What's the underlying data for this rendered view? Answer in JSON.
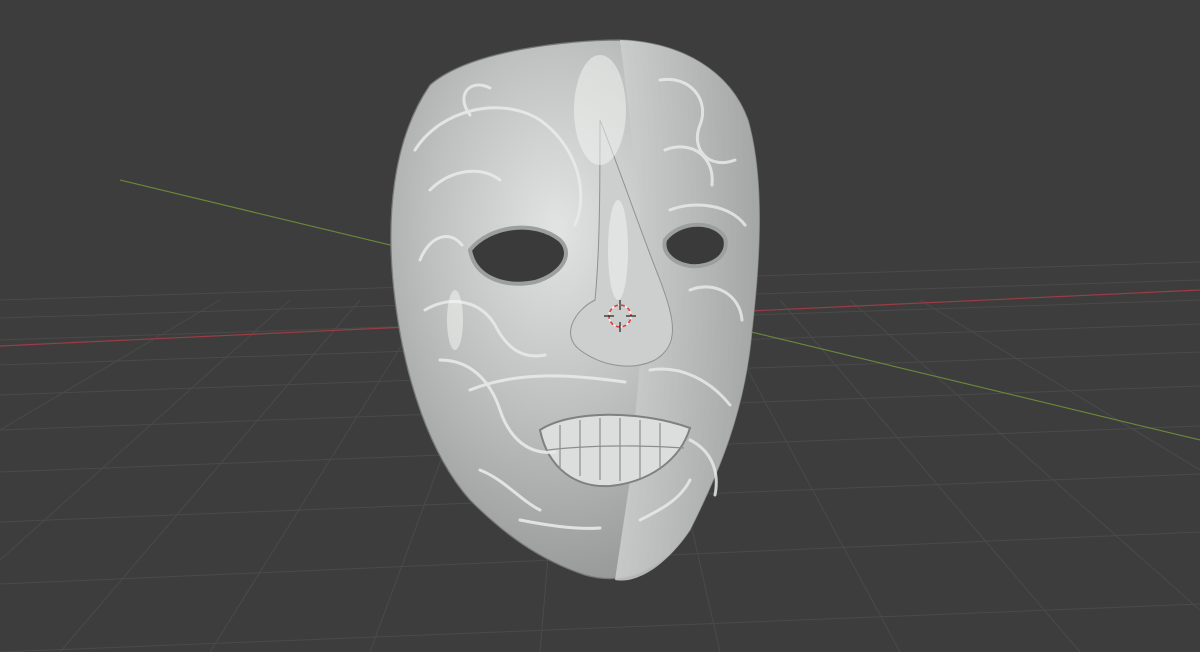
{
  "viewport": {
    "background_color": "#3d3d3d",
    "grid_line_color": "#4a4a4a",
    "x_axis_color": "#9a3d45",
    "y_axis_color": "#6b8a3a",
    "mesh_color": "#b9bbba",
    "mesh_shadow_color": "#8d8f8e",
    "mesh_highlight_color": "#e4e6e5",
    "cursor_color_primary": "#e04040",
    "cursor_color_secondary": "#f2f2f2"
  },
  "scene": {
    "object_icon": "mask-mesh-icon",
    "cursor_icon": "3d-cursor-icon",
    "grid_visible": true,
    "axes_visible": [
      "x",
      "y"
    ]
  }
}
